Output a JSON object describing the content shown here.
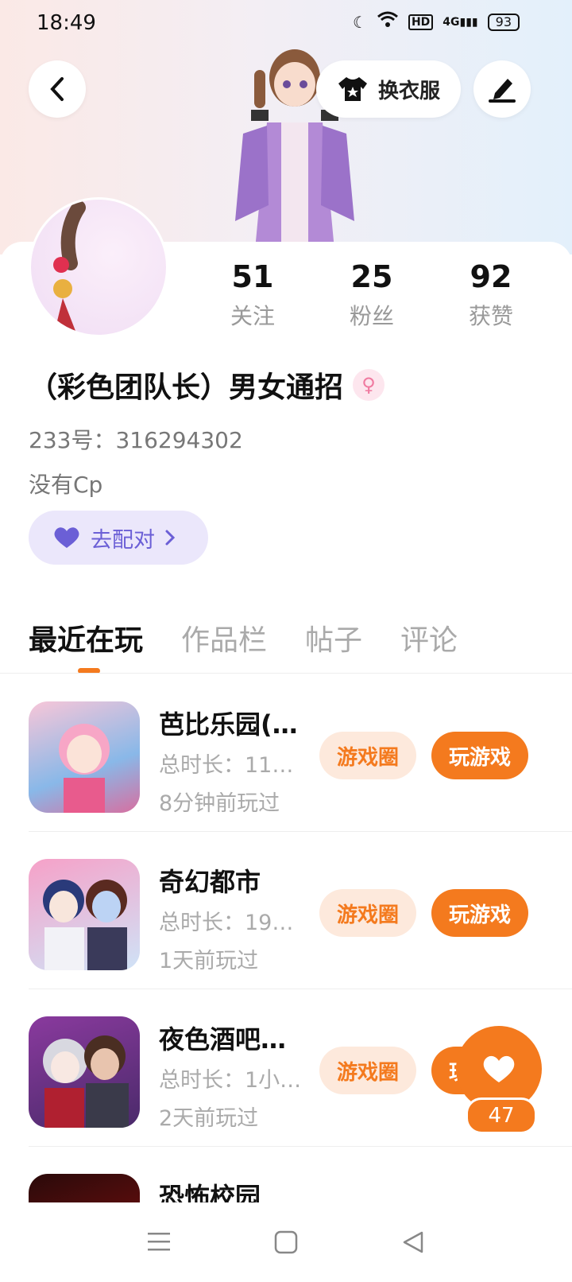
{
  "status_bar": {
    "time": "18:49",
    "battery": "93",
    "network": "4G",
    "hd": "HD"
  },
  "header": {
    "dress_up_label": "换衣服"
  },
  "stats": [
    {
      "value": "51",
      "label": "关注"
    },
    {
      "value": "25",
      "label": "粉丝"
    },
    {
      "value": "92",
      "label": "获赞"
    }
  ],
  "profile": {
    "name": "（彩色团队长）男女通招",
    "gender_icon": "female-icon",
    "id_line": "233号：316294302",
    "cp_line": "没有Cp",
    "match_label": "去配对"
  },
  "tabs": [
    "最近在玩",
    "作品栏",
    "帖子",
    "评论"
  ],
  "games": [
    {
      "title": "芭比乐园(…",
      "duration": "总时长：11…",
      "last_played": "8分钟前玩过",
      "circle_label": "游戏圈",
      "play_label": "玩游戏"
    },
    {
      "title": "奇幻都市",
      "duration": "总时长：19…",
      "last_played": "1天前玩过",
      "circle_label": "游戏圈",
      "play_label": "玩游戏"
    },
    {
      "title": "夜色酒吧…",
      "duration": "总时长：1小…",
      "last_played": "2天前玩过",
      "circle_label": "游戏圈",
      "play_label": "玩游戏"
    },
    {
      "title": "恐怖校园"
    }
  ],
  "like_count": "47",
  "colors": {
    "accent": "#f47a1e",
    "match_bg": "#ebe7fb",
    "match_text": "#6b5fd6"
  }
}
